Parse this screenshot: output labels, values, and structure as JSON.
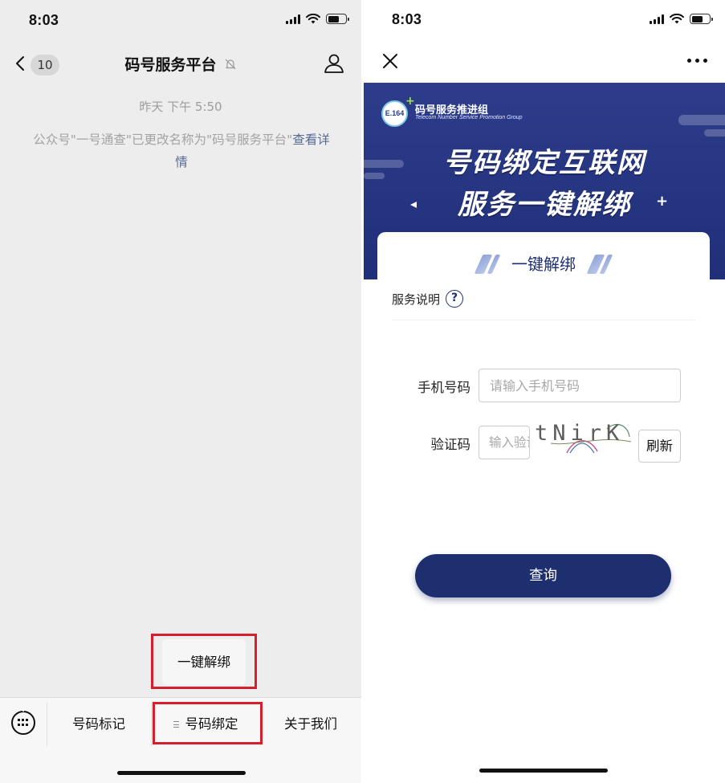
{
  "left_screen": {
    "status": {
      "time": "8:03"
    },
    "nav": {
      "unread_count": "10",
      "title": "码号服务平台"
    },
    "chat": {
      "time": "昨天 下午 5:50",
      "notice_text": "公众号\"一号通查\"已更改名称为\"码号服务平台\"",
      "notice_link": "查看详情"
    },
    "submenu": {
      "item": "一键解绑"
    },
    "menu": {
      "items": [
        "号码标记",
        "号码绑定",
        "关于我们"
      ]
    }
  },
  "right_screen": {
    "status": {
      "time": "8:03"
    },
    "banner": {
      "logo_text": "E.164",
      "org_name": "码号服务推进组",
      "org_en": "Telecom Number Service  Promotion Group",
      "line1": "号码绑定互联网",
      "line2": "服务一键解绑"
    },
    "card": {
      "title": "一键解绑",
      "service_label": "服务说明",
      "help_glyph": "?",
      "phone_label": "手机号码",
      "phone_placeholder": "请输入手机号码",
      "code_label": "验证码",
      "code_placeholder": "输入验证码",
      "captcha_text": "tNirK",
      "refresh_label": "刷新",
      "query_label": "查询"
    }
  },
  "colors": {
    "accent_navy": "#1e2f70",
    "banner_blue": "#2d3d8b",
    "highlight_red": "#d61e2d",
    "link_blue": "#576b95"
  },
  "icons": {
    "left": [
      "chevron-left-icon",
      "mute-bell-icon",
      "profile-icon",
      "keyboard-icon",
      "menu-lines-icon"
    ],
    "right": [
      "close-icon",
      "more-icon",
      "help-icon"
    ]
  }
}
